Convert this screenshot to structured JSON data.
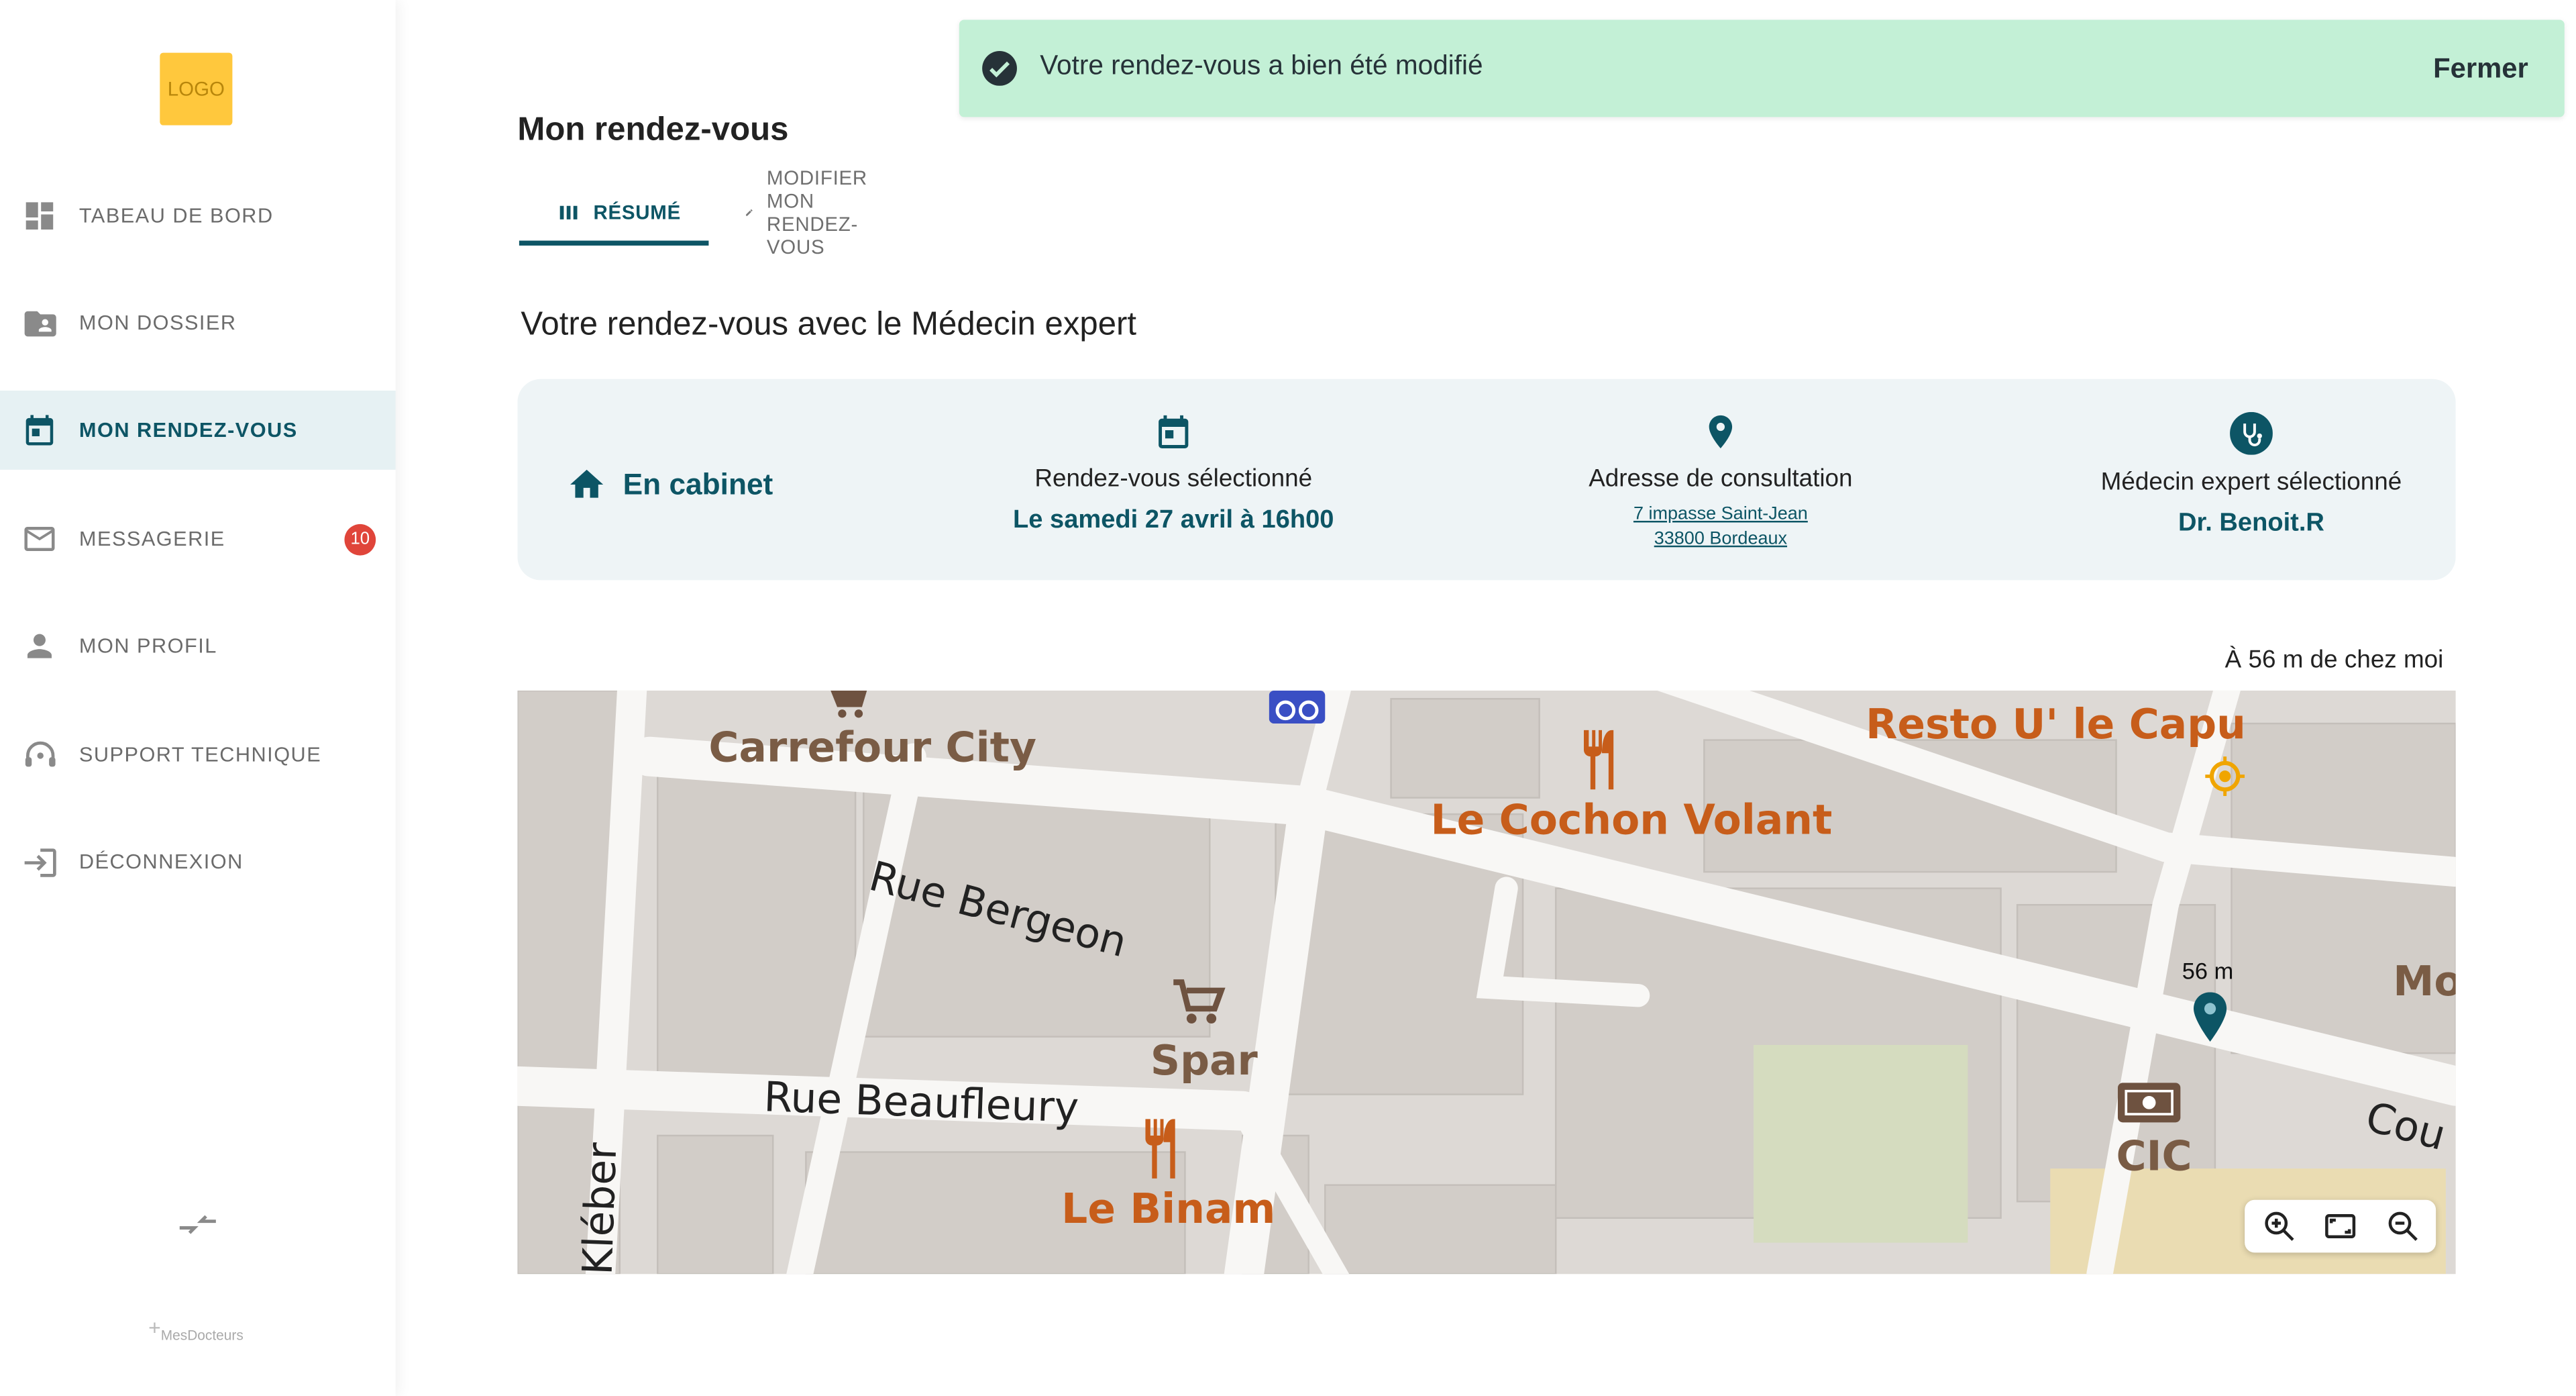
{
  "sidebar": {
    "logo": "LOGO",
    "items": [
      {
        "label": "TABEAU DE BORD",
        "icon": "dashboard-icon"
      },
      {
        "label": "MON DOSSIER",
        "icon": "folder-shared-icon"
      },
      {
        "label": "MON RENDEZ-VOUS",
        "icon": "calendar-icon",
        "active": true
      },
      {
        "label": "MESSAGERIE",
        "icon": "mail-icon",
        "badge": "10"
      },
      {
        "label": "MON PROFIL",
        "icon": "person-icon"
      },
      {
        "label": "SUPPORT TECHNIQUE",
        "icon": "support-icon"
      },
      {
        "label": "DÉCONNEXION",
        "icon": "logout-icon"
      }
    ],
    "brand": "MesDocteurs"
  },
  "toast": {
    "message": "Votre rendez-vous a bien été modifié",
    "close_label": "Fermer"
  },
  "main": {
    "title": "Mon rendez-vous",
    "tabs": [
      {
        "label": "RÉSUMÉ",
        "active": true
      },
      {
        "label": "MODIFIER MON RENDEZ-VOUS",
        "active": false
      }
    ],
    "section_title": "Votre rendez-vous avec le Médecin expert",
    "card": {
      "mode": "En cabinet",
      "appointment_label": "Rendez-vous sélectionné",
      "appointment_value": "Le samedi 27 avril à 16h00",
      "address_label": "Adresse de consultation",
      "address_line1": "7 impasse Saint-Jean",
      "address_line2": "33800 Bordeaux",
      "doctor_label": "Médecin expert sélectionné",
      "doctor_value": "Dr. Benoit.R"
    },
    "distance": "À 56 m de chez moi"
  },
  "map": {
    "labels": {
      "carrefour": "Carrefour City",
      "cochon": "Le Cochon Volant",
      "resto": "Resto U' le Capu",
      "bergeon": "Rue Bergeon",
      "spar": "Spar",
      "beaufleury": "Rue Beaufleury",
      "binam": "Le Binam",
      "kleber": "Kléber",
      "cic": "CIC",
      "mo": "Mo",
      "cou": "Cou"
    },
    "pin_distance": "56 m",
    "colors": {
      "poi_brown": "#7a5c45",
      "poi_orange": "#c75d1a",
      "pin": "#0d5565"
    }
  },
  "colors": {
    "accent": "#0d5565",
    "toast_bg": "#c3f0d6",
    "badge": "#e0453a",
    "logo": "#ffc83d"
  }
}
